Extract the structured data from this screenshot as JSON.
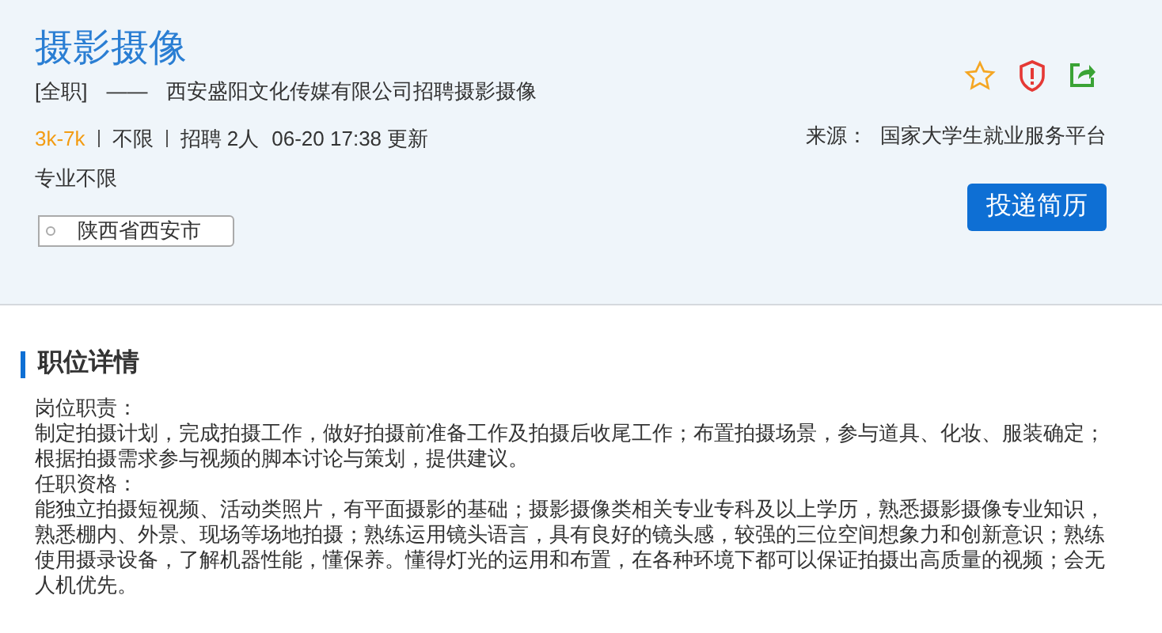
{
  "job": {
    "title": "摄影摄像",
    "type": "[全职]",
    "dash": "——",
    "subtitle": "西安盛阳文化传媒有限公司招聘摄影摄像",
    "salary": "3k-7k",
    "experience": "不限",
    "hiring": "招聘 2人",
    "updated": "06-20 17:38 更新",
    "major": "专业不限",
    "location": "陕西省西安市",
    "source_label": "来源：",
    "source": "国家大学生就业服务平台",
    "apply_button": "投递简历"
  },
  "details": {
    "heading": "职位详情",
    "paragraphs": [
      "岗位职责：",
      "制定拍摄计划，完成拍摄工作，做好拍摄前准备工作及拍摄后收尾工作；布置拍摄场景，参与道具、化妆、服装确定；根据拍摄需求参与视频的脚本讨论与策划，提供建议。",
      "任职资格：",
      "能独立拍摄短视频、活动类照片，有平面摄影的基础；摄影摄像类相关专业专科及以上学历，熟悉摄影摄像专业知识，熟悉棚内、外景、现场等场地拍摄；熟练运用镜头语言，具有良好的镜头感，较强的三位空间想象力和创新意识；熟练使用摄录设备，了解机器性能，懂保养。懂得灯光的运用和布置，在各种环境下都可以保证拍摄出高质量的视频；会无人机优先。"
    ]
  }
}
